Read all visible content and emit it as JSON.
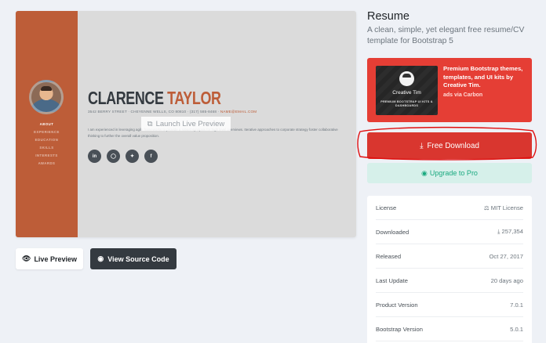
{
  "preview": {
    "name_first": "CLARENCE",
    "name_last": "TAYLOR",
    "address": "3542 BERRY STREET · CHEYENNE WELLS, CO 80810 · (317) 585-8468 ·",
    "email": "NAME@EMAIL.COM",
    "bio": "I am experienced in leveraging agile frameworks to provide a robust synopsis for high level overviews. Iterative approaches to corporate strategy foster collaborative thinking to further the overall value proposition.",
    "nav": [
      "ABOUT",
      "EXPERIENCE",
      "EDUCATION",
      "SKILLS",
      "INTERESTS",
      "AWARDS"
    ],
    "social_icons": [
      "linkedin-icon",
      "github-icon",
      "twitter-icon",
      "facebook-icon"
    ],
    "social_glyphs": [
      "in",
      "◯",
      "✦",
      "f"
    ],
    "launch_label": "Launch Live Preview",
    "launch_icon": "external-link-icon",
    "accent_color": "#bd5d38"
  },
  "buttons": {
    "live_preview": "Live Preview",
    "view_source": "View Source Code"
  },
  "template": {
    "title": "Resume",
    "description": "A clean, simple, yet elegant free resume/CV template for Bootstrap 5"
  },
  "ad": {
    "image_brand": "Creative Tim",
    "image_tagline": "PREMIUM BOOTSTRAP UI KITS & DASHBOARDS",
    "text": "Premium Bootstrap themes, templates, and UI kits by Creative Tim.",
    "via": "ads via Carbon",
    "color": "#e53e35"
  },
  "actions": {
    "free_download": "Free Download",
    "upgrade_pro": "Upgrade to Pro",
    "download_color": "#d9362f",
    "pro_color": "#1aa97f"
  },
  "stats": [
    {
      "label": "License",
      "value": "MIT License",
      "icon": "license-icon"
    },
    {
      "label": "Downloaded",
      "value": "257,354",
      "icon": "download-icon"
    },
    {
      "label": "Released",
      "value": "Oct 27, 2017",
      "icon": ""
    },
    {
      "label": "Last Update",
      "value": "20 days ago",
      "icon": ""
    },
    {
      "label": "Product Version",
      "value": "7.0.1",
      "icon": ""
    },
    {
      "label": "Bootstrap Version",
      "value": "5.0.1",
      "icon": ""
    }
  ]
}
